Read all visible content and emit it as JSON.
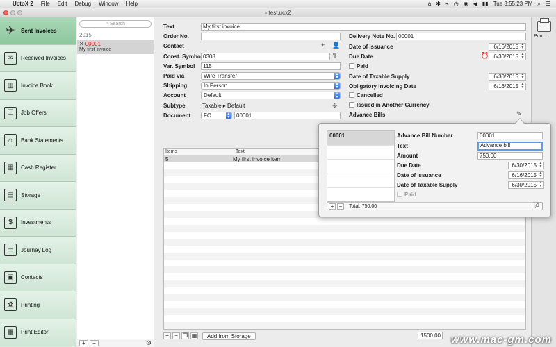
{
  "menubar": {
    "apple": "",
    "items": [
      "UctoX 2",
      "File",
      "Edit",
      "Debug",
      "Window",
      "Help"
    ],
    "status": [
      "a",
      "✱",
      "⌁",
      "◷",
      "◉",
      "◀",
      "▮▮"
    ],
    "clock": "Tue 3:55:23 PM"
  },
  "window": {
    "title": "test.ucx2"
  },
  "sidebar": {
    "items": [
      {
        "label": "Sent Invoices",
        "icon": "paper-plane-icon",
        "glyph": "✈"
      },
      {
        "label": "Received Invoices",
        "icon": "envelope-icon",
        "glyph": "✉"
      },
      {
        "label": "Invoice Book",
        "icon": "books-icon",
        "glyph": "▥"
      },
      {
        "label": "Job Offers",
        "icon": "hand-box-icon",
        "glyph": "☐"
      },
      {
        "label": "Bank Statements",
        "icon": "bank-icon",
        "glyph": "⌂"
      },
      {
        "label": "Cash Register",
        "icon": "cash-register-icon",
        "glyph": "▦"
      },
      {
        "label": "Storage",
        "icon": "storage-icon",
        "glyph": "▤"
      },
      {
        "label": "Investments",
        "icon": "dollar-icon",
        "glyph": "$"
      },
      {
        "label": "Journey Log",
        "icon": "truck-icon",
        "glyph": "▭"
      },
      {
        "label": "Contacts",
        "icon": "contact-card-icon",
        "glyph": "▣"
      },
      {
        "label": "Printing",
        "icon": "printer-icon",
        "glyph": "⎙"
      },
      {
        "label": "Print Editor",
        "icon": "print-editor-icon",
        "glyph": "▦"
      }
    ]
  },
  "list": {
    "search_placeholder": "Search",
    "year": "2015",
    "invoice": {
      "number": "00001",
      "text": "My first invoice"
    },
    "add": "+",
    "remove": "−",
    "gear": "⚙"
  },
  "form": {
    "text_label": "Text",
    "text_value": "My first invoice",
    "order_label": "Order No.",
    "order_value": "",
    "contact_label": "Contact",
    "const_label": "Const. Symbol",
    "const_value": "0308",
    "var_label": "Var. Symbol",
    "var_value": "115",
    "paidvia_label": "Paid via",
    "paidvia_value": "Wire Transfer",
    "shipping_label": "Shipping",
    "shipping_value": "In Person",
    "account_label": "Account",
    "account_value": "Default",
    "subtype_label": "Subtype",
    "subtype_value": "Taxable ▸ Default",
    "document_label": "Document",
    "document_series": "FO",
    "document_number": "00001",
    "delivery_label": "Delivery Note No.",
    "delivery_value": "00001",
    "issuance_label": "Date of Issuance",
    "issuance_value": "6/16/2015",
    "due_label": "Due Date",
    "due_value": "6/30/2015",
    "paid_label": "Paid",
    "taxable_label": "Date of Taxable Supply",
    "taxable_value": "6/30/2015",
    "obligatory_label": "Obligatory Invoicing Date",
    "obligatory_value": "6/16/2015",
    "cancelled_label": "Cancelled",
    "currency_label": "Issued in Another Currency",
    "advance_label": "Advance Bills"
  },
  "items": {
    "col_items": "Items",
    "col_text": "Text",
    "rows": [
      {
        "qty": "5",
        "text": "My first invoice item"
      }
    ],
    "add_from_storage": "Add from Storage",
    "total": "1500.00"
  },
  "toolbar": {
    "print_label": "Print..."
  },
  "popover": {
    "list": [
      "00001"
    ],
    "number_label": "Advance Bill Number",
    "number_value": "00001",
    "text_label": "Text",
    "text_value": "Advance bill",
    "amount_label": "Amount",
    "amount_value": "750.00",
    "due_label": "Due Date",
    "due_value": "6/30/2015",
    "issuance_label": "Date of Issuance",
    "issuance_value": "6/16/2015",
    "taxable_label": "Date of Taxable Supply",
    "taxable_value": "6/30/2015",
    "paid_label": "Paid",
    "total_label": "Total:",
    "total_value": "750.00"
  },
  "watermark": "www.mac-gm.com",
  "colors": {
    "sidebar_bg": "#d6ebdc",
    "sidebar_active": "#8ec79e",
    "invoice_number": "#d42020",
    "focus": "#5b9cf0"
  }
}
